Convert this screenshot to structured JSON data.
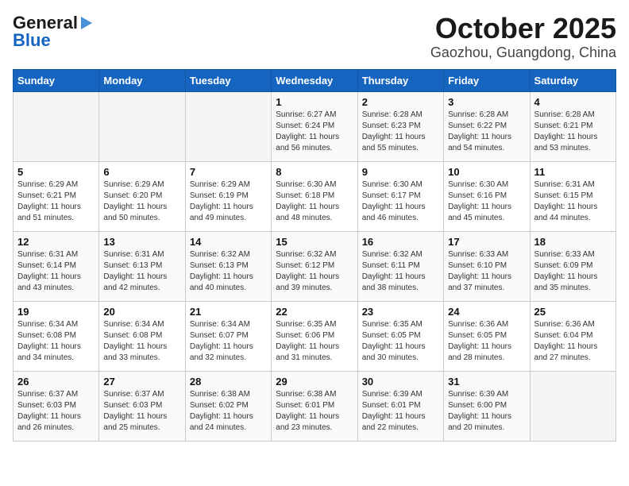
{
  "header": {
    "logo_line1": "General",
    "logo_line2": "Blue",
    "month_title": "October 2025",
    "location": "Gaozhou, Guangdong, China"
  },
  "weekdays": [
    "Sunday",
    "Monday",
    "Tuesday",
    "Wednesday",
    "Thursday",
    "Friday",
    "Saturday"
  ],
  "weeks": [
    [
      {
        "day": "",
        "info": ""
      },
      {
        "day": "",
        "info": ""
      },
      {
        "day": "",
        "info": ""
      },
      {
        "day": "1",
        "info": "Sunrise: 6:27 AM\nSunset: 6:24 PM\nDaylight: 11 hours and 56 minutes."
      },
      {
        "day": "2",
        "info": "Sunrise: 6:28 AM\nSunset: 6:23 PM\nDaylight: 11 hours and 55 minutes."
      },
      {
        "day": "3",
        "info": "Sunrise: 6:28 AM\nSunset: 6:22 PM\nDaylight: 11 hours and 54 minutes."
      },
      {
        "day": "4",
        "info": "Sunrise: 6:28 AM\nSunset: 6:21 PM\nDaylight: 11 hours and 53 minutes."
      }
    ],
    [
      {
        "day": "5",
        "info": "Sunrise: 6:29 AM\nSunset: 6:21 PM\nDaylight: 11 hours and 51 minutes."
      },
      {
        "day": "6",
        "info": "Sunrise: 6:29 AM\nSunset: 6:20 PM\nDaylight: 11 hours and 50 minutes."
      },
      {
        "day": "7",
        "info": "Sunrise: 6:29 AM\nSunset: 6:19 PM\nDaylight: 11 hours and 49 minutes."
      },
      {
        "day": "8",
        "info": "Sunrise: 6:30 AM\nSunset: 6:18 PM\nDaylight: 11 hours and 48 minutes."
      },
      {
        "day": "9",
        "info": "Sunrise: 6:30 AM\nSunset: 6:17 PM\nDaylight: 11 hours and 46 minutes."
      },
      {
        "day": "10",
        "info": "Sunrise: 6:30 AM\nSunset: 6:16 PM\nDaylight: 11 hours and 45 minutes."
      },
      {
        "day": "11",
        "info": "Sunrise: 6:31 AM\nSunset: 6:15 PM\nDaylight: 11 hours and 44 minutes."
      }
    ],
    [
      {
        "day": "12",
        "info": "Sunrise: 6:31 AM\nSunset: 6:14 PM\nDaylight: 11 hours and 43 minutes."
      },
      {
        "day": "13",
        "info": "Sunrise: 6:31 AM\nSunset: 6:13 PM\nDaylight: 11 hours and 42 minutes."
      },
      {
        "day": "14",
        "info": "Sunrise: 6:32 AM\nSunset: 6:13 PM\nDaylight: 11 hours and 40 minutes."
      },
      {
        "day": "15",
        "info": "Sunrise: 6:32 AM\nSunset: 6:12 PM\nDaylight: 11 hours and 39 minutes."
      },
      {
        "day": "16",
        "info": "Sunrise: 6:32 AM\nSunset: 6:11 PM\nDaylight: 11 hours and 38 minutes."
      },
      {
        "day": "17",
        "info": "Sunrise: 6:33 AM\nSunset: 6:10 PM\nDaylight: 11 hours and 37 minutes."
      },
      {
        "day": "18",
        "info": "Sunrise: 6:33 AM\nSunset: 6:09 PM\nDaylight: 11 hours and 35 minutes."
      }
    ],
    [
      {
        "day": "19",
        "info": "Sunrise: 6:34 AM\nSunset: 6:08 PM\nDaylight: 11 hours and 34 minutes."
      },
      {
        "day": "20",
        "info": "Sunrise: 6:34 AM\nSunset: 6:08 PM\nDaylight: 11 hours and 33 minutes."
      },
      {
        "day": "21",
        "info": "Sunrise: 6:34 AM\nSunset: 6:07 PM\nDaylight: 11 hours and 32 minutes."
      },
      {
        "day": "22",
        "info": "Sunrise: 6:35 AM\nSunset: 6:06 PM\nDaylight: 11 hours and 31 minutes."
      },
      {
        "day": "23",
        "info": "Sunrise: 6:35 AM\nSunset: 6:05 PM\nDaylight: 11 hours and 30 minutes."
      },
      {
        "day": "24",
        "info": "Sunrise: 6:36 AM\nSunset: 6:05 PM\nDaylight: 11 hours and 28 minutes."
      },
      {
        "day": "25",
        "info": "Sunrise: 6:36 AM\nSunset: 6:04 PM\nDaylight: 11 hours and 27 minutes."
      }
    ],
    [
      {
        "day": "26",
        "info": "Sunrise: 6:37 AM\nSunset: 6:03 PM\nDaylight: 11 hours and 26 minutes."
      },
      {
        "day": "27",
        "info": "Sunrise: 6:37 AM\nSunset: 6:03 PM\nDaylight: 11 hours and 25 minutes."
      },
      {
        "day": "28",
        "info": "Sunrise: 6:38 AM\nSunset: 6:02 PM\nDaylight: 11 hours and 24 minutes."
      },
      {
        "day": "29",
        "info": "Sunrise: 6:38 AM\nSunset: 6:01 PM\nDaylight: 11 hours and 23 minutes."
      },
      {
        "day": "30",
        "info": "Sunrise: 6:39 AM\nSunset: 6:01 PM\nDaylight: 11 hours and 22 minutes."
      },
      {
        "day": "31",
        "info": "Sunrise: 6:39 AM\nSunset: 6:00 PM\nDaylight: 11 hours and 20 minutes."
      },
      {
        "day": "",
        "info": ""
      }
    ]
  ]
}
